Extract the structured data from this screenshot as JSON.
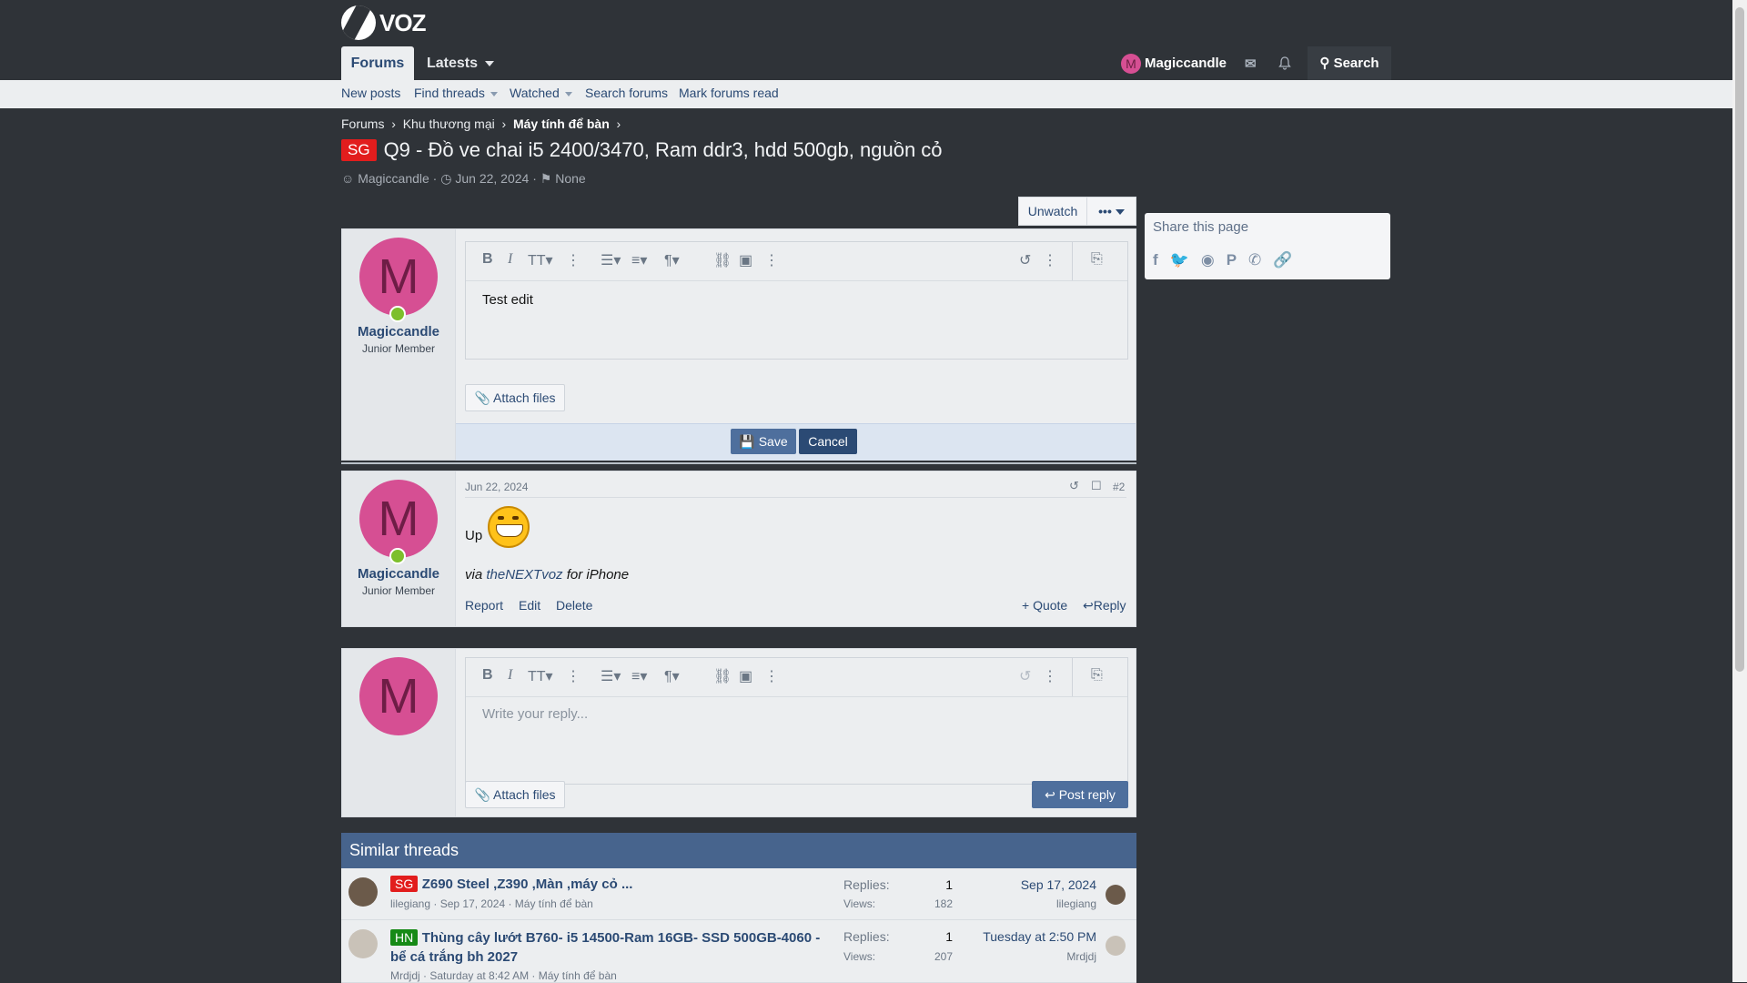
{
  "brand": {
    "name": "VOZ"
  },
  "nav": {
    "tabs": [
      {
        "label": "Forums"
      },
      {
        "label": "Latests"
      }
    ],
    "user": {
      "name": "Magiccandle",
      "initial": "M"
    },
    "search_label": "Search"
  },
  "subnav": {
    "items": [
      {
        "label": "New posts"
      },
      {
        "label": "Find threads"
      },
      {
        "label": "Watched"
      },
      {
        "label": "Search forums"
      },
      {
        "label": "Mark forums read"
      }
    ]
  },
  "breadcrumb": [
    "Forums",
    "Khu thương mại",
    "Máy tính để bàn"
  ],
  "thread": {
    "prefix": "SG",
    "title": "Q9 - Đồ ve chai i5 2400/3470, Ram ddr3, hdd 500gb, nguồn cỏ",
    "author": "Magiccandle",
    "date": "Jun 22, 2024",
    "tags": "None",
    "unwatch_label": "Unwatch",
    "more_label": "•••"
  },
  "share": {
    "title": "Share this page",
    "icons": [
      "facebook-icon",
      "twitter-icon",
      "reddit-icon",
      "pinterest-icon",
      "whatsapp-icon",
      "link-icon"
    ]
  },
  "edit_post": {
    "avatar_initial": "M",
    "username": "Magiccandle",
    "user_title": "Junior Member",
    "editor_text": "Test edit",
    "attach_label": "Attach files",
    "save_label": "Save",
    "cancel_label": "Cancel"
  },
  "post2": {
    "avatar_initial": "M",
    "username": "Magiccandle",
    "user_title": "Junior Member",
    "date": "Jun 22, 2024",
    "number": "#2",
    "body": "Up",
    "via_prefix": "via",
    "via_link": "theNEXTvoz",
    "via_suffix": "for iPhone",
    "actions": {
      "report": "Report",
      "edit": "Edit",
      "delete": "Delete",
      "quote": "+ Quote",
      "reply": "Reply"
    }
  },
  "reply_box": {
    "avatar_initial": "M",
    "placeholder": "Write your reply...",
    "attach_label": "Attach files",
    "post_label": "Post reply"
  },
  "similar": {
    "heading": "Similar threads",
    "threads": [
      {
        "prefix": "SG",
        "title": "Z690 Steel ,Z390 ,Màn ,máy cỏ ...",
        "author": "lilegiang",
        "date": "Sep 17, 2024",
        "forum": "Máy tính để bàn",
        "replies_label": "Replies:",
        "replies": "1",
        "views_label": "Views:",
        "views": "182",
        "last_date": "Sep 17, 2024",
        "last_user": "lilegiang"
      },
      {
        "prefix": "HN",
        "title": "Thùng cây lướt B760- i5 14500-Ram 16GB- SSD 500GB-4060 - bể cá trắng bh 2027",
        "author": "Mrdjdj",
        "date": "Saturday at 8:42 AM",
        "forum": "Máy tính để bàn",
        "replies_label": "Replies:",
        "replies": "1",
        "views_label": "Views:",
        "views": "207",
        "last_date": "Tuesday at 2:50 PM",
        "last_user": "Mrdjdj"
      }
    ]
  }
}
